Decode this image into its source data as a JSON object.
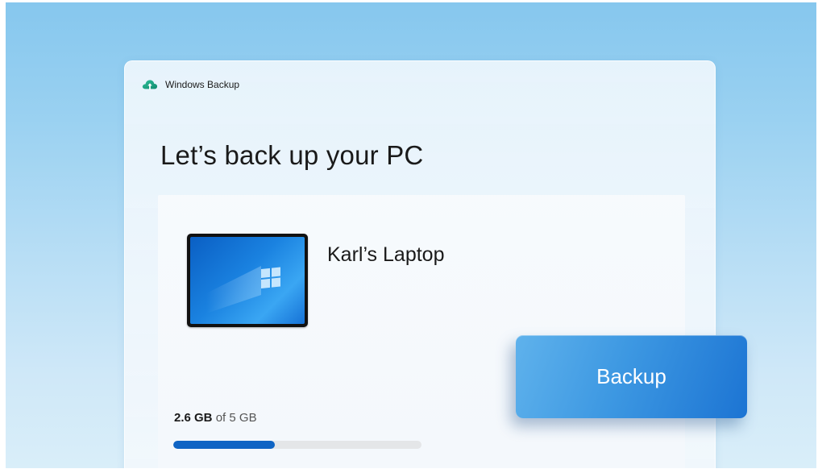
{
  "app": {
    "title": "Windows Backup",
    "icon": "cloud-upload-icon"
  },
  "main": {
    "heading": "Let’s back up your PC"
  },
  "device": {
    "name": "Karl’s Laptop",
    "image_icon": "laptop-icon"
  },
  "storage": {
    "used": "2.6 GB",
    "separator": " of ",
    "total": "5 GB",
    "progress_fraction": 0.41
  },
  "actions": {
    "backup_label": "Backup"
  },
  "colors": {
    "accent": "#0f64c4",
    "button": "#3d98e2",
    "background": "#9ad1f1"
  }
}
